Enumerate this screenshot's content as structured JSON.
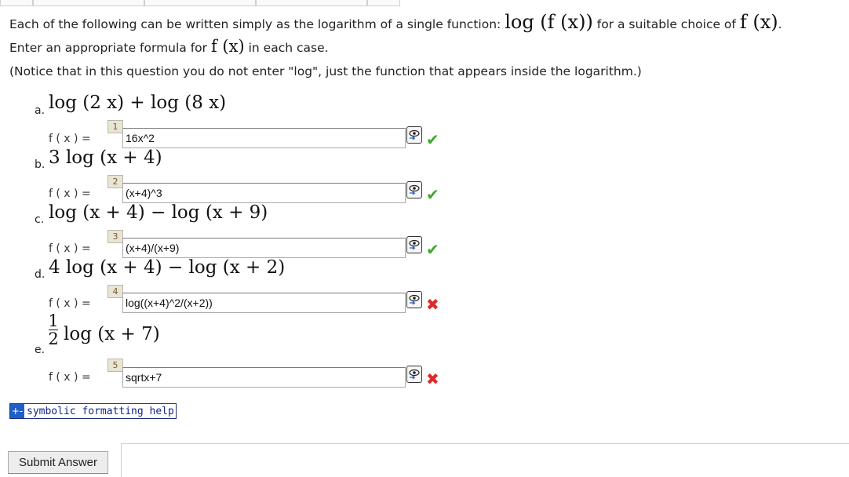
{
  "intro": {
    "line1_pre": "Each of the following can be written simply as the logarithm of a single function:",
    "line1_math": "log (f (x))",
    "line1_mid": "for a suitable choice of",
    "line1_math2": "f (x)",
    "line1_end": ".",
    "line2_pre": "Enter an appropriate formula for",
    "line2_math": "f (x)",
    "line2_post": "in each case.",
    "line3": "(Notice that in this question you do not enter \"log\", just the function that appears inside the logarithm.)"
  },
  "items": [
    {
      "letter": "a.",
      "expr": "log (2 x) + log (8 x)",
      "flabel": "f ( x ) =",
      "qnum": "1",
      "answer": "16x^2",
      "status": "correct"
    },
    {
      "letter": "b.",
      "expr": "3 log (x + 4)",
      "flabel": "f ( x ) =",
      "qnum": "2",
      "answer": "(x+4)^3",
      "status": "correct"
    },
    {
      "letter": "c.",
      "expr": "log (x + 4) − log (x + 9)",
      "flabel": "f ( x ) =",
      "qnum": "3",
      "answer": "(x+4)/(x+9)",
      "status": "correct"
    },
    {
      "letter": "d.",
      "expr": "4 log (x + 4) − log (x + 2)",
      "flabel": "f ( x ) =",
      "qnum": "4",
      "answer": "log((x+4)^2/(x+2))",
      "status": "incorrect"
    },
    {
      "letter": "e.",
      "expr_num": "1",
      "expr_den": "2",
      "expr": "log (x + 7)",
      "flabel": "f ( x ) =",
      "qnum": "5",
      "answer": "sqrtx+7",
      "status": "incorrect"
    }
  ],
  "marks": {
    "correct": "✔",
    "incorrect": "✖"
  },
  "preview_icon": "preview-eye-icon",
  "symbolic_help": {
    "icon": "+-",
    "label": "symbolic formatting help"
  },
  "submit_label": "Submit Answer",
  "colors": {
    "correct": "#3ea92a",
    "incorrect": "#e32727",
    "help_link": "#12248a"
  }
}
